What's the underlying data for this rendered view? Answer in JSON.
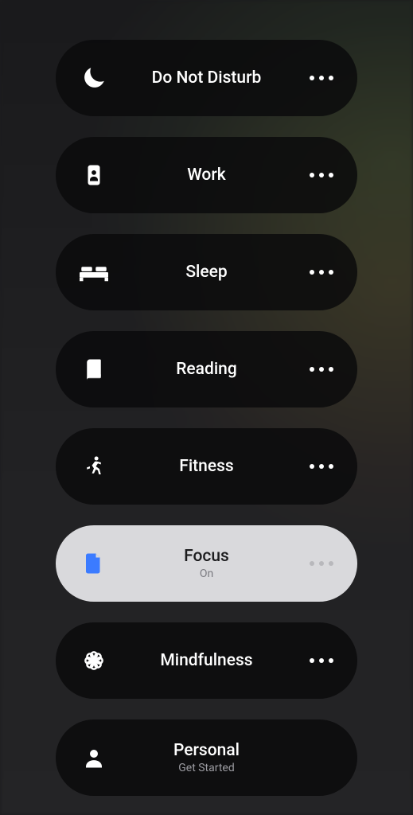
{
  "focus_modes": [
    {
      "id": "dnd",
      "label": "Do Not Disturb",
      "sublabel": "",
      "icon": "moon",
      "active": false,
      "showMore": true
    },
    {
      "id": "work",
      "label": "Work",
      "sublabel": "",
      "icon": "badge",
      "active": false,
      "showMore": true
    },
    {
      "id": "sleep",
      "label": "Sleep",
      "sublabel": "",
      "icon": "bed",
      "active": false,
      "showMore": true
    },
    {
      "id": "reading",
      "label": "Reading",
      "sublabel": "",
      "icon": "book",
      "active": false,
      "showMore": true
    },
    {
      "id": "fitness",
      "label": "Fitness",
      "sublabel": "",
      "icon": "runner",
      "active": false,
      "showMore": true
    },
    {
      "id": "focus",
      "label": "Focus",
      "sublabel": "On",
      "icon": "doc",
      "active": true,
      "showMore": true
    },
    {
      "id": "mindfulness",
      "label": "Mindfulness",
      "sublabel": "",
      "icon": "flower",
      "active": false,
      "showMore": true
    },
    {
      "id": "personal",
      "label": "Personal",
      "sublabel": "Get Started",
      "icon": "person",
      "active": false,
      "showMore": false
    }
  ],
  "colors": {
    "pill_bg": "#0a0a0c",
    "pill_active_bg": "#d9d9dc",
    "accent": "#3b7bff"
  }
}
